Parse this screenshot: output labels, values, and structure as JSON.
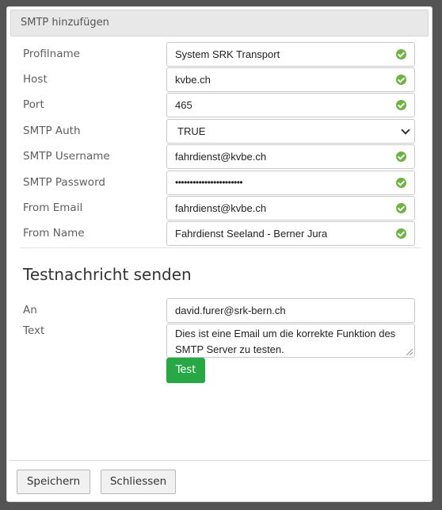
{
  "dialog": {
    "title": "SMTP hinzufügen"
  },
  "form": {
    "fields": [
      {
        "label": "Profilname",
        "value": "System SRK Transport",
        "status": "valid"
      },
      {
        "label": "Host",
        "value": "kvbe.ch",
        "status": "valid"
      },
      {
        "label": "Port",
        "value": "465",
        "status": "valid"
      },
      {
        "label": "SMTP Auth",
        "value": "TRUE",
        "type": "select"
      },
      {
        "label": "SMTP Username",
        "value": "fahrdienst@kvbe.ch",
        "status": "valid"
      },
      {
        "label": "SMTP Password",
        "value": "•••••••••••••••••••••••",
        "status": "valid"
      },
      {
        "label": "From Email",
        "value": "fahrdienst@kvbe.ch",
        "status": "valid"
      },
      {
        "label": "From Name",
        "value": "Fahrdienst Seeland - Berner Jura",
        "status": "valid"
      }
    ]
  },
  "test": {
    "title": "Testnachricht senden",
    "to_label": "An",
    "to_value": "david.furer@srk-bern.ch",
    "text_label": "Text",
    "text_value": "Dies ist eine Email um die korrekte Funktion des SMTP Server zu testen.",
    "button_label": "Test"
  },
  "footer": {
    "save_label": "Speichern",
    "close_label": "Schliessen"
  },
  "colors": {
    "valid": "#6db33f",
    "test_button": "#28a745",
    "backdrop": "#545454"
  }
}
